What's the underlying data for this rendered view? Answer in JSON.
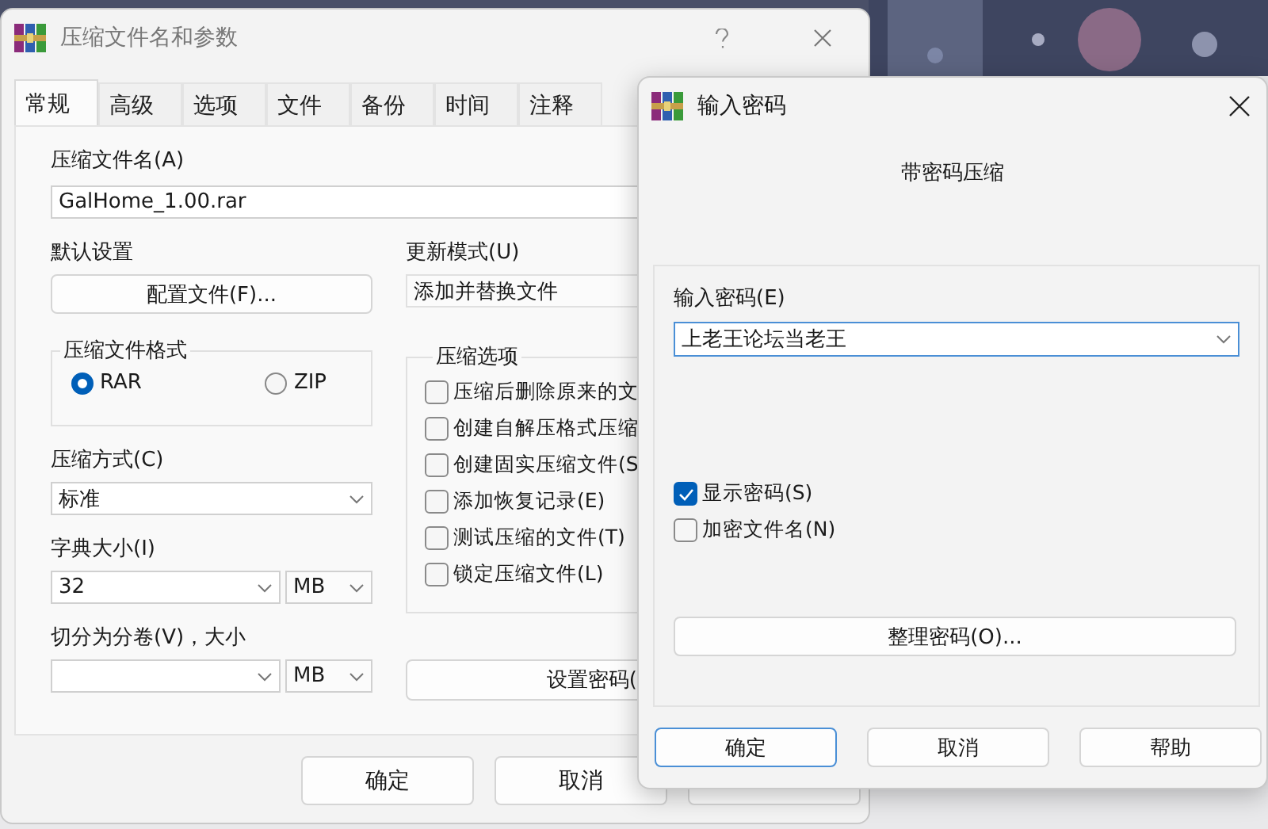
{
  "main_window": {
    "title": "压缩文件名和参数",
    "tabs": [
      {
        "label": "常规",
        "selected": true
      },
      {
        "label": "高级",
        "selected": false
      },
      {
        "label": "选项",
        "selected": false
      },
      {
        "label": "文件",
        "selected": false
      },
      {
        "label": "备份",
        "selected": false
      },
      {
        "label": "时间",
        "selected": false
      },
      {
        "label": "注释",
        "selected": false
      }
    ],
    "archive_name": {
      "label": "压缩文件名(A)",
      "value": "GalHome_1.00.rar"
    },
    "profiles": {
      "label": "默认设置",
      "button": "配置文件(F)..."
    },
    "update_mode": {
      "label": "更新模式(U)",
      "value": "添加并替换文件"
    },
    "archive_format": {
      "label": "压缩文件格式",
      "options": [
        {
          "label": "RAR",
          "selected": true
        },
        {
          "label": "ZIP",
          "selected": false
        }
      ]
    },
    "method": {
      "label": "压缩方式(C)",
      "value": "标准"
    },
    "dictionary": {
      "label": "字典大小(I)",
      "value": "32",
      "unit": "MB"
    },
    "split": {
      "label": "切分为分卷(V)，大小",
      "unit": "MB"
    },
    "options": {
      "label": "压缩选项",
      "items": [
        {
          "label": "压缩后删除原来的文",
          "checked": false
        },
        {
          "label": "创建自解压格式压缩",
          "checked": false
        },
        {
          "label": "创建固实压缩文件(S",
          "checked": false
        },
        {
          "label": "添加恢复记录(E)",
          "checked": false
        },
        {
          "label": "测试压缩的文件(T)",
          "checked": false
        },
        {
          "label": "锁定压缩文件(L)",
          "checked": false
        }
      ]
    },
    "set_password_button": "设置密码(",
    "buttons": [
      "确定",
      "取消"
    ]
  },
  "password_dialog": {
    "title": "输入密码",
    "heading": "带密码压缩",
    "password_label": "输入密码(E)",
    "password_value": "上老王论坛当老王",
    "options": [
      {
        "label": "显示密码(S)",
        "checked": true
      },
      {
        "label": "加密文件名(N)",
        "checked": false
      }
    ],
    "organize_button": "整理密码(O)...",
    "buttons": [
      {
        "label": "确定",
        "default": true
      },
      {
        "label": "取消",
        "default": false
      },
      {
        "label": "帮助",
        "default": false
      }
    ]
  }
}
